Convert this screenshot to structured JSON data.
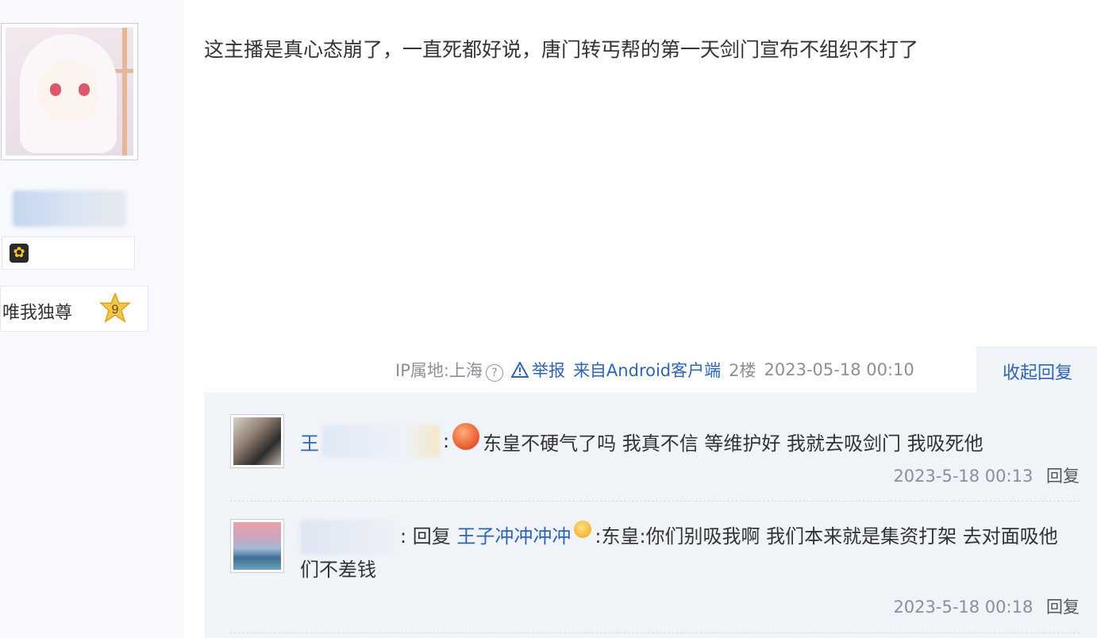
{
  "post": {
    "text": "这主播是真心态崩了，一直死都好说，唐门转丐帮的第一天剑门宣布不组织不打了"
  },
  "author": {
    "level_title": "唯我独尊",
    "level": "9"
  },
  "meta": {
    "ip_label": "IP属地:上海",
    "help_icon": "?",
    "report_label": "举报",
    "client_label": "来自Android客户端",
    "floor": "2楼",
    "time": "2023-05-18 00:10",
    "collapse_label": "收起回复"
  },
  "replies": [
    {
      "user_prefix": "王",
      "separator": ":",
      "text": "东皇不硬气了吗 我真不信 等维护好 我就去吸剑门 我吸死他",
      "time": "2023-5-18 00:13",
      "reply_label": "回复"
    },
    {
      "separator": ":",
      "reply_prefix": "回复",
      "reply_to": "王子冲冲冲冲",
      "text": ":东皇:你们别吸我啊 我们本来就是集资打架 去对面吸他们不差钱",
      "time": "2023-5-18 00:18",
      "reply_label": "回复"
    }
  ],
  "colors": {
    "link": "#2d64b3",
    "meta": "#8a8f99",
    "reply_bg": "#f0f3f8"
  },
  "icons": [
    "help-icon",
    "warning-icon",
    "orange-emoji-icon",
    "smiley-emoji-icon",
    "level-star-icon",
    "badge-icon"
  ]
}
